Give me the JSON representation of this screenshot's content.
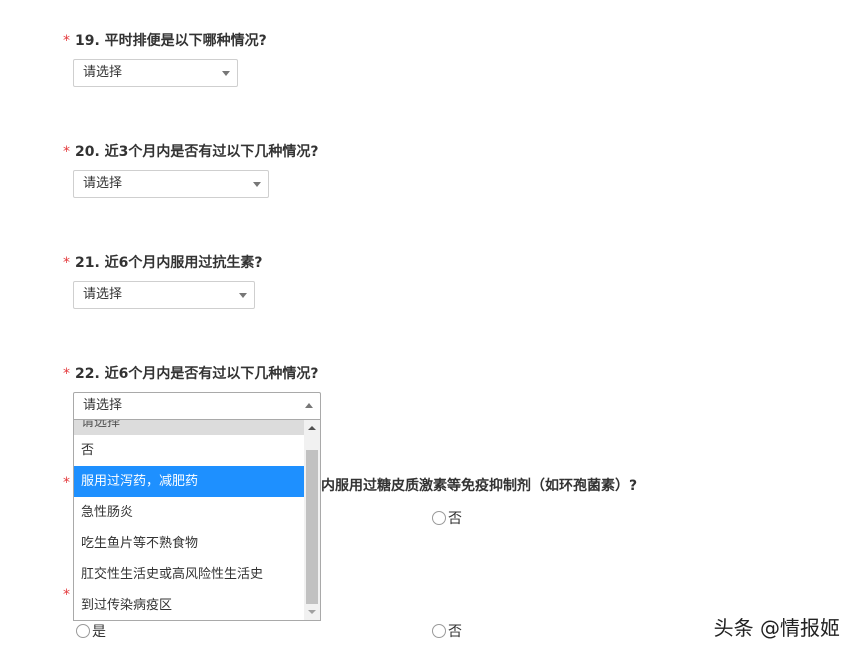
{
  "questions": {
    "q19": {
      "title": "19. 平时排便是以下哪种情况?",
      "placeholder": "请选择"
    },
    "q20": {
      "title": "20. 近3个月内是否有过以下几种情况?",
      "placeholder": "请选择"
    },
    "q21": {
      "title": "21. 近6个月内服用过抗生素?",
      "placeholder": "请选择"
    },
    "q22": {
      "title": "22. 近6个月内是否有过以下几种情况?",
      "placeholder": "请选择"
    },
    "q23": {
      "title_visible": "内服用过糖皮质激素等免疫抑制剂（如环孢菌素）?"
    }
  },
  "required_mark": "*",
  "dropdown": {
    "options": [
      "请选择",
      "否",
      "服用过泻药，减肥药",
      "急性肠炎",
      "吃生鱼片等不熟食物",
      "肛交性生活史或高风险性生活史",
      "到过传染病疫区"
    ],
    "highlighted_index": 2
  },
  "radios": {
    "yes": "是",
    "no": "否"
  },
  "watermark": "头条 @情报姬",
  "colors": {
    "highlight": "#1e90ff",
    "required": "#e4393c"
  }
}
